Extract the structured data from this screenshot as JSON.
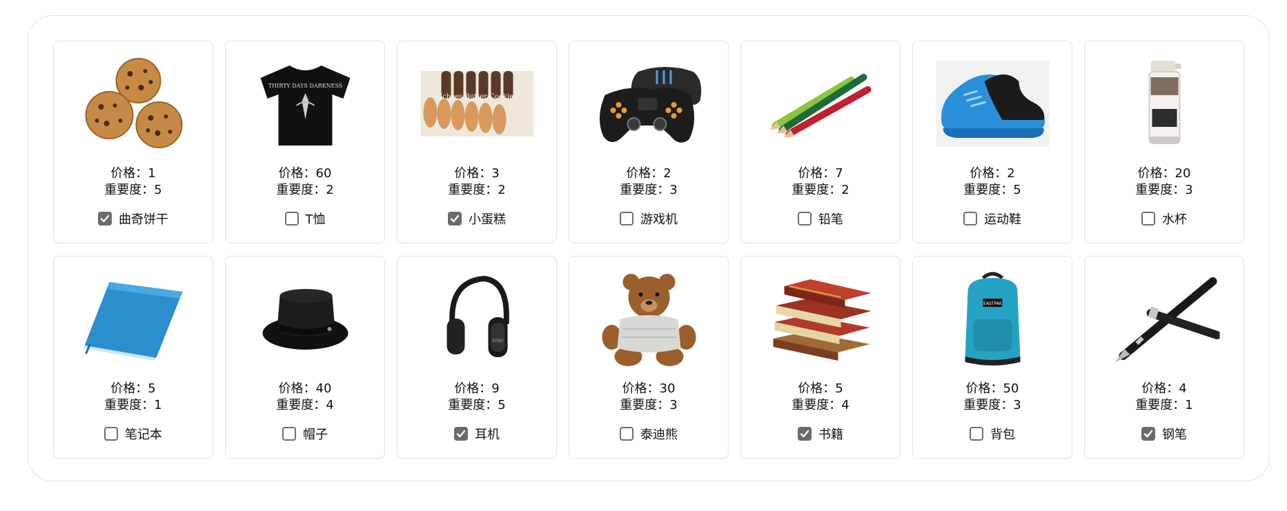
{
  "price_prefix": "价格：",
  "importance_prefix": "重要度：",
  "items": [
    {
      "name": "曲奇饼干",
      "price": "1",
      "importance": "5",
      "checked": true,
      "icon": "cookies-icon"
    },
    {
      "name": "T恤",
      "price": "60",
      "importance": "2",
      "checked": false,
      "icon": "tshirt-icon"
    },
    {
      "name": "小蛋糕",
      "price": "3",
      "importance": "2",
      "checked": true,
      "icon": "cake-icon"
    },
    {
      "name": "游戏机",
      "price": "2",
      "importance": "3",
      "checked": false,
      "icon": "gamepad-icon"
    },
    {
      "name": "铅笔",
      "price": "7",
      "importance": "2",
      "checked": false,
      "icon": "pencils-icon"
    },
    {
      "name": "运动鞋",
      "price": "2",
      "importance": "5",
      "checked": false,
      "icon": "sneaker-icon"
    },
    {
      "name": "水杯",
      "price": "20",
      "importance": "3",
      "checked": false,
      "icon": "cup-icon"
    },
    {
      "name": "笔记本",
      "price": "5",
      "importance": "1",
      "checked": false,
      "icon": "notebook-icon"
    },
    {
      "name": "帽子",
      "price": "40",
      "importance": "4",
      "checked": false,
      "icon": "hat-icon"
    },
    {
      "name": "耳机",
      "price": "9",
      "importance": "5",
      "checked": true,
      "icon": "headphones-icon"
    },
    {
      "name": "泰迪熊",
      "price": "30",
      "importance": "3",
      "checked": false,
      "icon": "teddy-bear-icon"
    },
    {
      "name": "书籍",
      "price": "5",
      "importance": "4",
      "checked": true,
      "icon": "books-icon"
    },
    {
      "name": "背包",
      "price": "50",
      "importance": "3",
      "checked": false,
      "icon": "backpack-icon"
    },
    {
      "name": "钢笔",
      "price": "4",
      "importance": "1",
      "checked": true,
      "icon": "pen-icon"
    }
  ],
  "colors": {
    "card_border": "#e1e1e1",
    "checkbox_checked": "#6b6b6b"
  }
}
